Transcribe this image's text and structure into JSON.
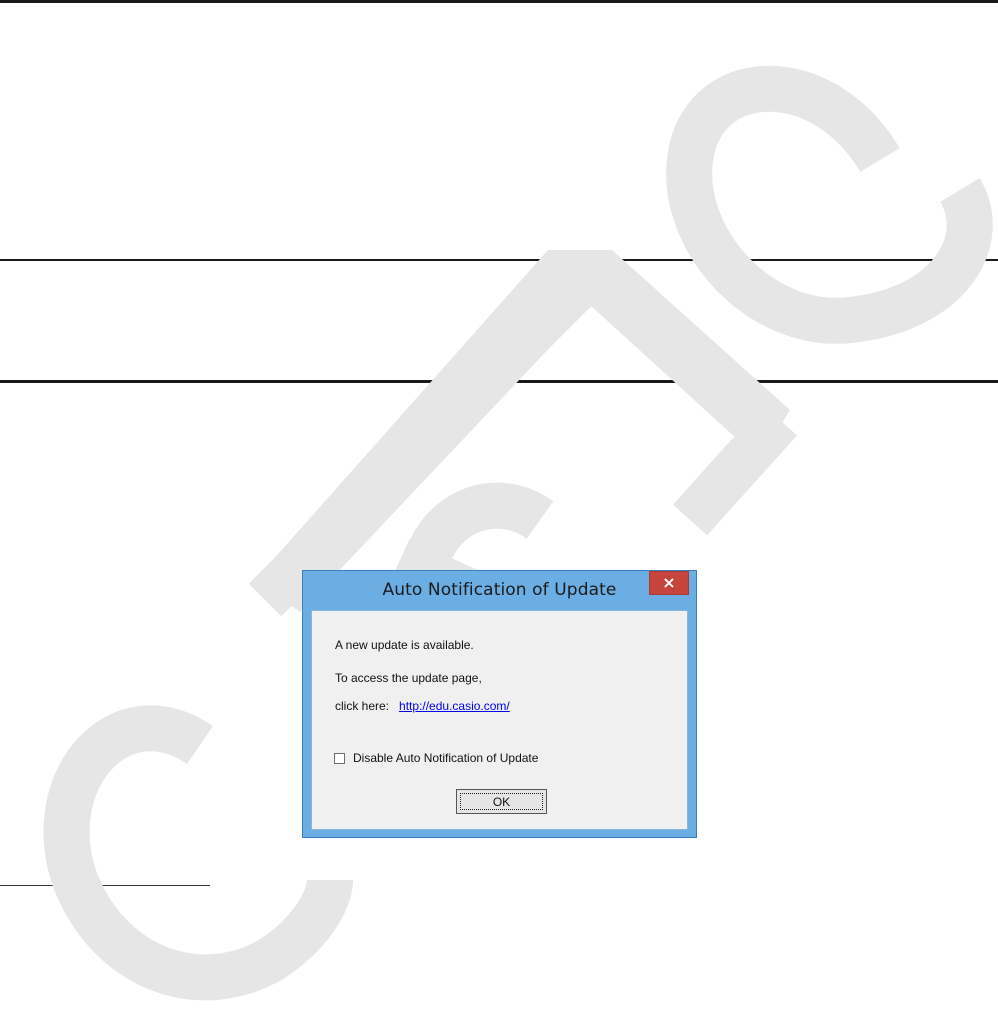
{
  "watermark": {
    "text": "CASIO",
    "color": "#e6e6e6"
  },
  "dialog": {
    "title": "Auto Notification of Update",
    "close_label": "×",
    "message_available": "A new update is available.",
    "message_access": "To access the update page,",
    "click_label": "click here:",
    "link_text": "http://edu.casio.com/",
    "checkbox_label": "Disable Auto Notification of Update",
    "checkbox_checked": false,
    "ok_label": "OK",
    "colors": {
      "frame": "#6aaee3",
      "close_button": "#c7443d",
      "client_bg": "#f0f0f0",
      "link": "#0000ee"
    }
  }
}
